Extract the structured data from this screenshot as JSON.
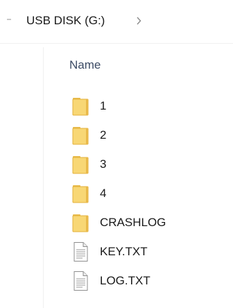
{
  "breadcrumb": {
    "location_label": "USB DISK (G:)",
    "chevron_icon": "chevron-right-icon"
  },
  "file_list": {
    "column_header": "Name",
    "items": [
      {
        "name": "1",
        "type": "folder",
        "icon": "folder-icon"
      },
      {
        "name": "2",
        "type": "folder",
        "icon": "folder-icon"
      },
      {
        "name": "3",
        "type": "folder",
        "icon": "folder-icon"
      },
      {
        "name": "4",
        "type": "folder",
        "icon": "folder-icon"
      },
      {
        "name": "CRASHLOG",
        "type": "folder",
        "icon": "folder-icon"
      },
      {
        "name": "KEY.TXT",
        "type": "text-file",
        "icon": "text-file-icon"
      },
      {
        "name": "LOG.TXT",
        "type": "text-file",
        "icon": "text-file-icon"
      }
    ]
  },
  "colors": {
    "folder_fill": "#f8d775",
    "folder_edge": "#e3b13a",
    "header_text": "#3b4a64",
    "text": "#1a1a1a"
  }
}
